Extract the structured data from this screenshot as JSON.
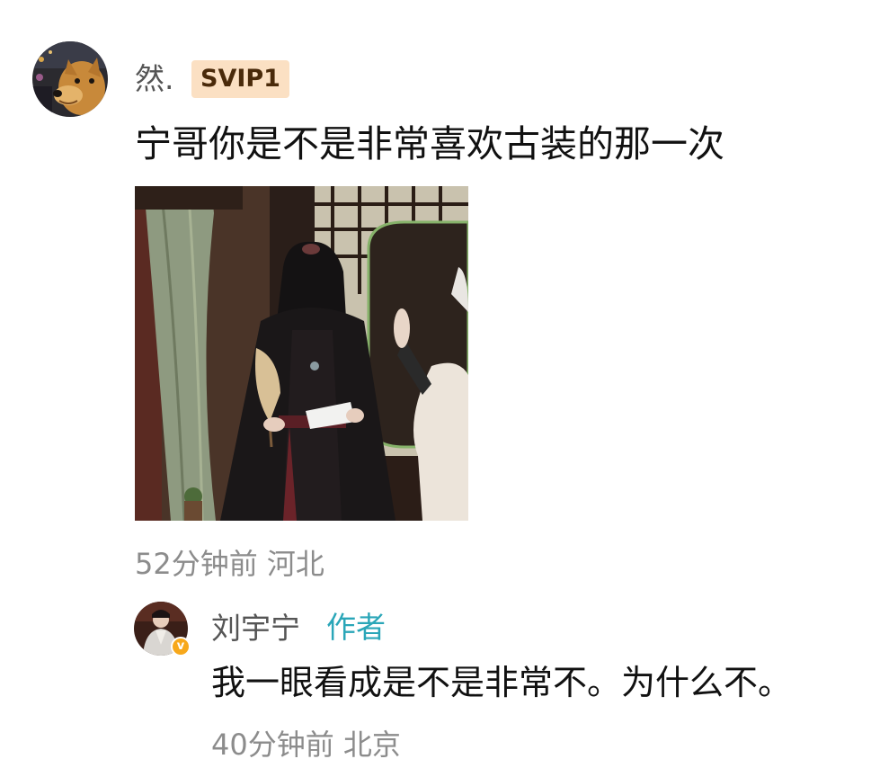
{
  "comment": {
    "user_name": "然.",
    "vip_badge": "SVIP1",
    "text": "宁哥你是不是非常喜欢古装的那一次",
    "image_alt": "photo",
    "time": "52分钟前",
    "location": "河北",
    "reply": {
      "user_name": "刘宇宁",
      "author_tag": "作者",
      "verified_icon": "verified-badge-icon",
      "verified_symbol": "v",
      "text": "我一眼看成是不是非常不。为什么不。",
      "time": "40分钟前",
      "location": "北京"
    }
  },
  "colors": {
    "vip_badge_bg": "#fbe0c3",
    "author_tag": "#2aa6b8",
    "meta_text": "#8c8c8c",
    "verified_badge": "#f7a81b"
  }
}
